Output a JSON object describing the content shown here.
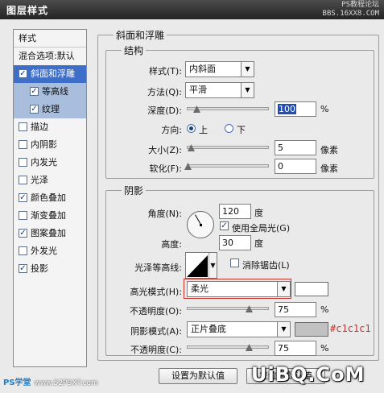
{
  "window": {
    "title": "图层样式",
    "watermark_line1": "PS教程论坛",
    "watermark_line2": "BBS.16XX8.COM"
  },
  "sidebar": {
    "header": "样式",
    "blend_options": "混合选项:默认",
    "items": [
      {
        "label": "斜面和浮雕",
        "checked": true,
        "selected": true
      },
      {
        "label": "等高线",
        "checked": true,
        "sub": true
      },
      {
        "label": "纹理",
        "checked": true,
        "sub": true
      },
      {
        "label": "描边",
        "checked": false
      },
      {
        "label": "内阴影",
        "checked": false
      },
      {
        "label": "内发光",
        "checked": false
      },
      {
        "label": "光泽",
        "checked": false
      },
      {
        "label": "颜色叠加",
        "checked": true
      },
      {
        "label": "渐变叠加",
        "checked": false
      },
      {
        "label": "图案叠加",
        "checked": true
      },
      {
        "label": "外发光",
        "checked": false
      },
      {
        "label": "投影",
        "checked": true
      }
    ]
  },
  "bevel": {
    "group_title": "斜面和浮雕",
    "structure": {
      "title": "结构",
      "style_label": "样式(T):",
      "style_value": "内斜面",
      "technique_label": "方法(Q):",
      "technique_value": "平滑",
      "depth_label": "深度(D):",
      "depth_value": "100",
      "depth_unit": "%",
      "direction_label": "方向:",
      "direction_up": "上",
      "direction_down": "下",
      "direction_selected": "上",
      "size_label": "大小(Z):",
      "size_value": "5",
      "size_unit": "像素",
      "soften_label": "软化(F):",
      "soften_value": "0",
      "soften_unit": "像素"
    },
    "shading": {
      "title": "阴影",
      "angle_label": "角度(N):",
      "angle_value": "120",
      "angle_unit": "度",
      "global_light_label": "使用全局光(G)",
      "global_light_checked": true,
      "altitude_label": "高度:",
      "altitude_value": "30",
      "altitude_unit": "度",
      "gloss_contour_label": "光泽等高线:",
      "anti_alias_label": "消除锯齿(L)",
      "anti_alias_checked": false,
      "highlight_mode_label": "高光模式(H):",
      "highlight_mode_value": "柔光",
      "highlight_color": "#ffffff",
      "highlight_opacity_label": "不透明度(O):",
      "highlight_opacity_value": "75",
      "highlight_opacity_unit": "%",
      "shadow_mode_label": "阴影模式(A):",
      "shadow_mode_value": "正片叠底",
      "shadow_color": "#c1c1c1",
      "shadow_color_note": "#c1c1c1",
      "shadow_opacity_label": "不透明度(C):",
      "shadow_opacity_value": "75",
      "shadow_opacity_unit": "%"
    }
  },
  "buttons": {
    "set_default": "设置为默认值",
    "reset_default": "复位为默认值"
  },
  "watermarks": {
    "bottom_left": "PS学堂",
    "bottom_left_domain": "www.52PSXT.com",
    "bottom_right": "UiBQ.CoM"
  }
}
